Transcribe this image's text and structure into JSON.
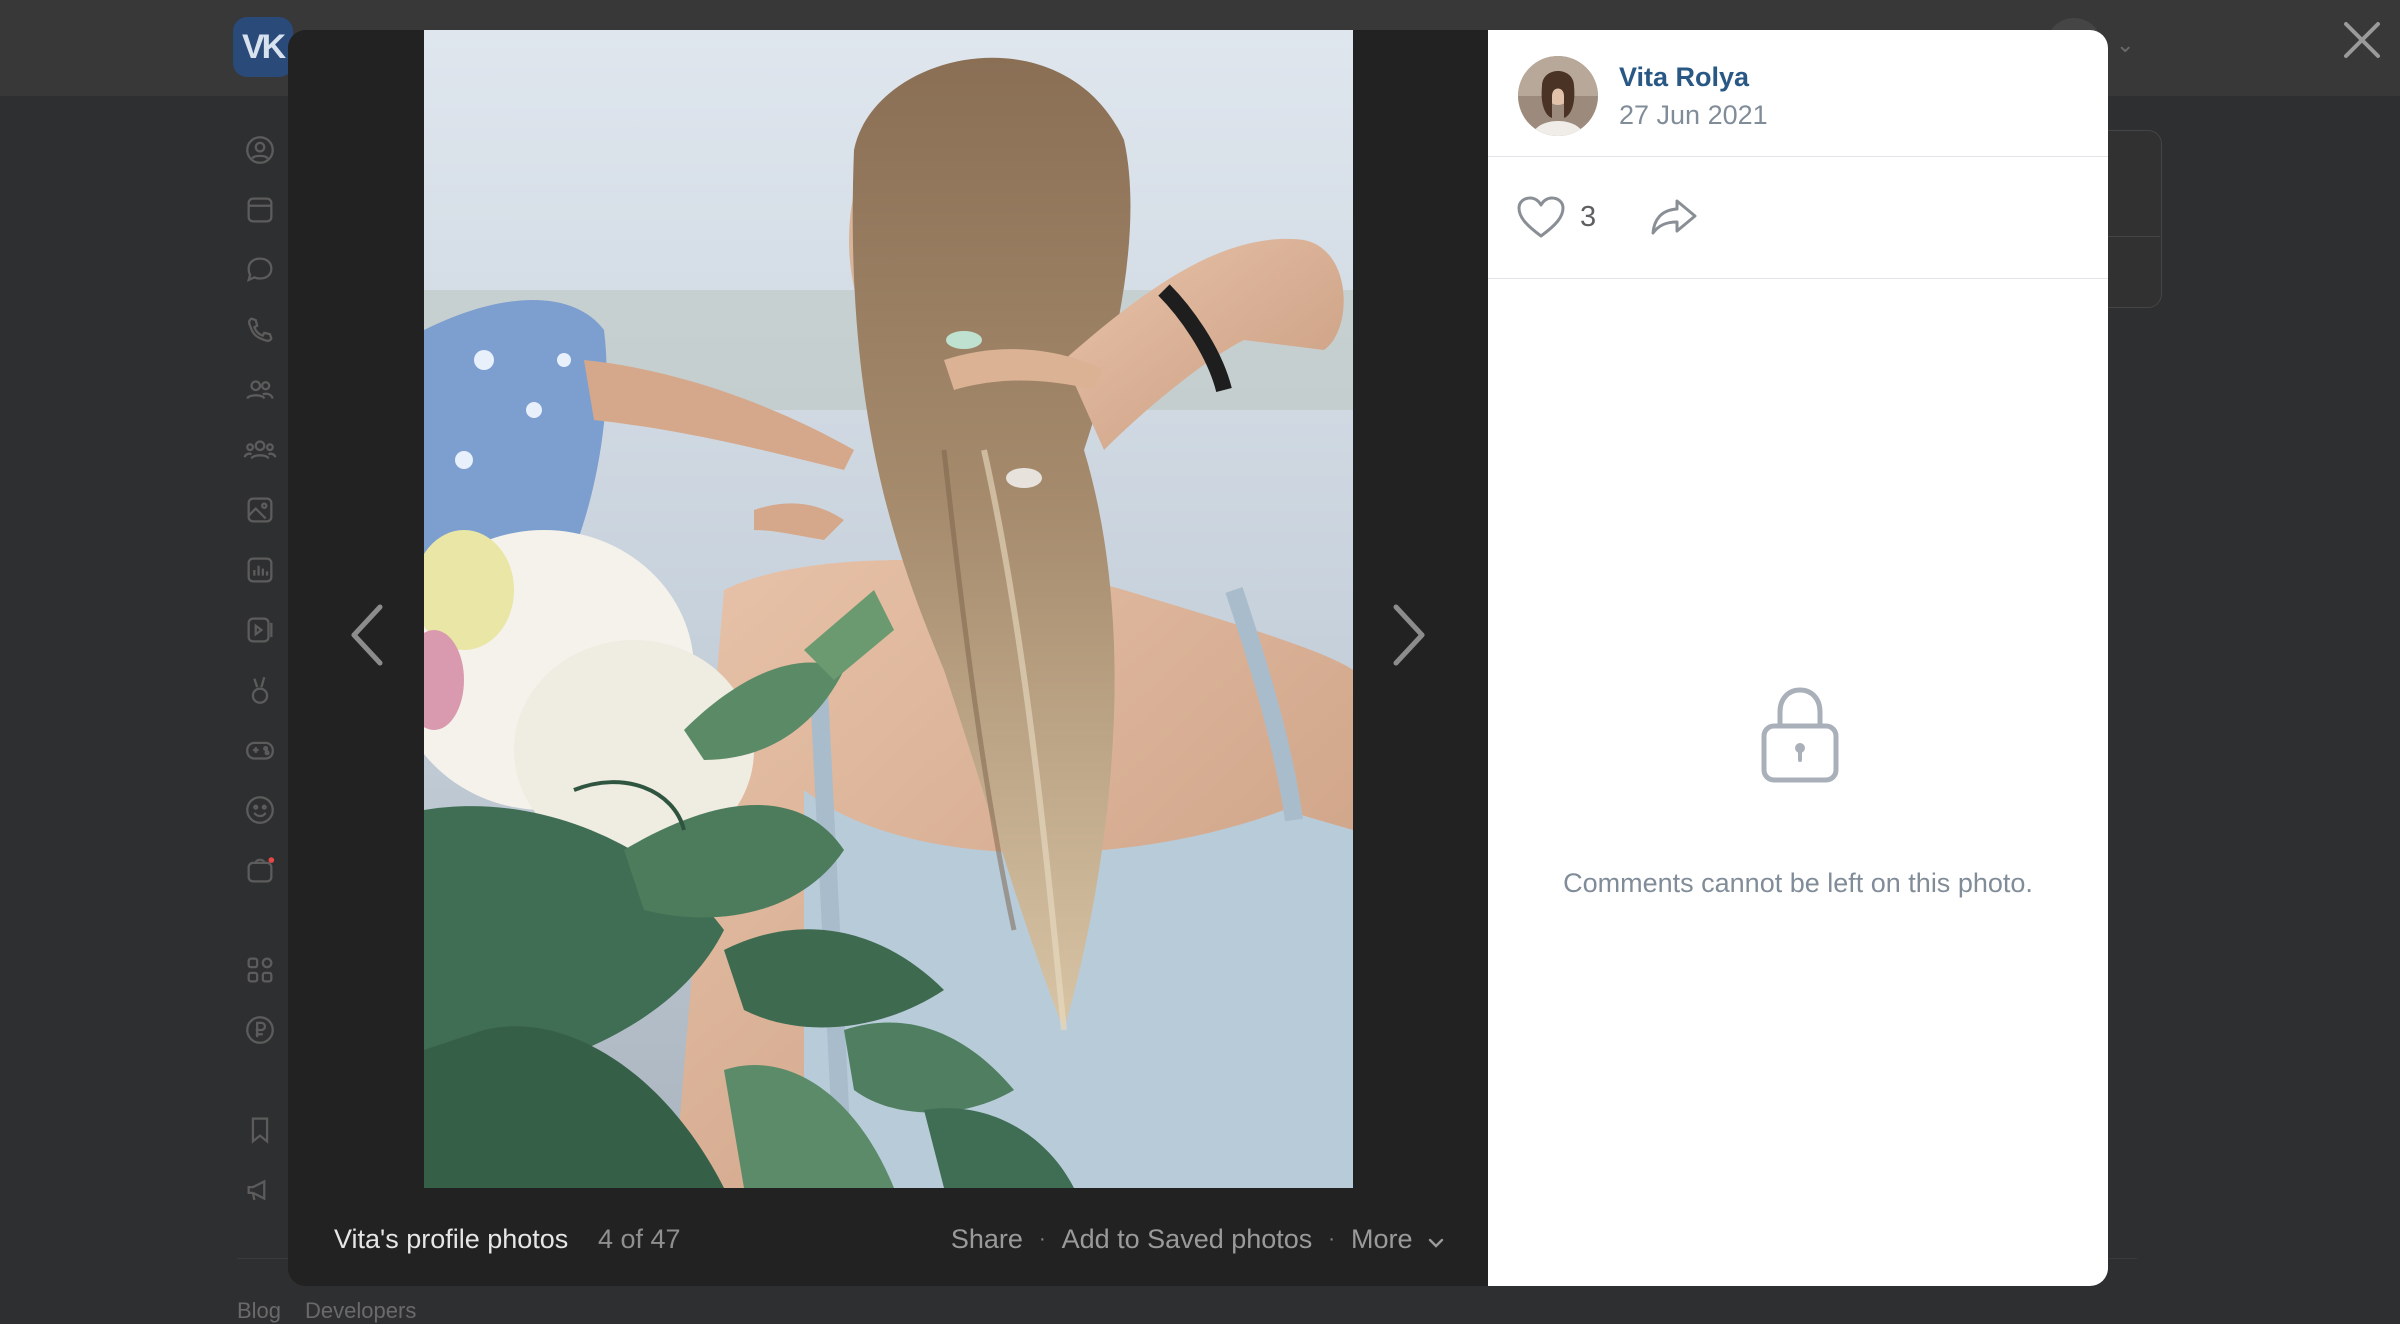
{
  "background": {
    "logo_text": "VK",
    "footer_links": [
      "Blog",
      "Developers"
    ]
  },
  "viewer": {
    "album_title": "Vita's profile photos",
    "counter": "4 of 47",
    "actions": {
      "share": "Share",
      "save": "Add to Saved photos",
      "more": "More"
    }
  },
  "post": {
    "author_name": "Vita Rolya",
    "date": "27 Jun 2021",
    "likes": "3"
  },
  "comments": {
    "locked_message": "Comments cannot be left on this photo."
  },
  "colors": {
    "link": "#2a5885",
    "secondary_text": "#818c99",
    "overlay": "#2e2f30",
    "viewer_bg": "#222222"
  },
  "icons": [
    "close-icon",
    "chevron-left-icon",
    "chevron-right-icon",
    "heart-icon",
    "share-icon",
    "lock-icon",
    "chevron-down-icon"
  ]
}
